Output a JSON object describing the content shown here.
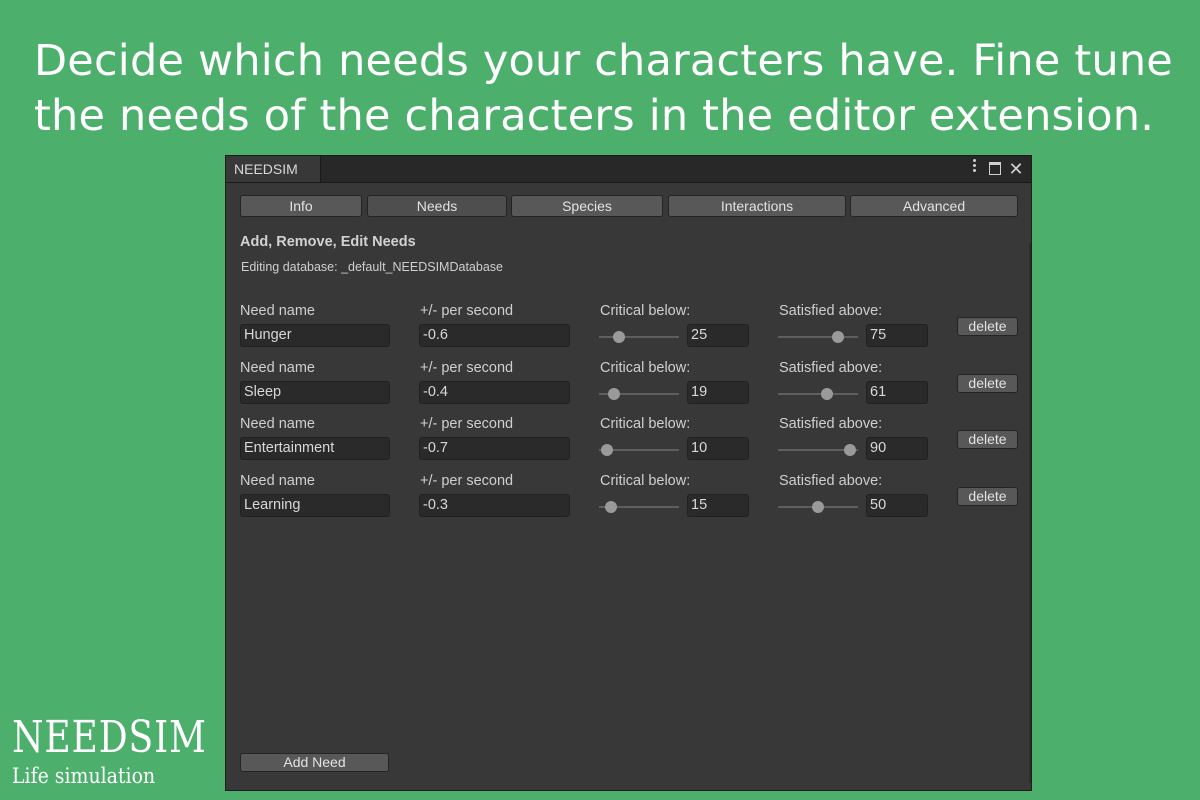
{
  "headline": {
    "line1": "Decide which needs your characters have. Fine tune",
    "line2": "the needs of the characters in the editor extension."
  },
  "logo": {
    "title": "NEEDSIM",
    "subtitle": "Life simulation"
  },
  "window": {
    "tab_title": "NEEDSIM",
    "tabs": [
      {
        "label": "Info"
      },
      {
        "label": "Needs"
      },
      {
        "label": "Species"
      },
      {
        "label": "Interactions"
      },
      {
        "label": "Advanced"
      }
    ],
    "section_title": "Add, Remove, Edit Needs",
    "database_label": "Editing database: _default_NEEDSIMDatabase",
    "labels": {
      "need_name": "Need name",
      "per_second": "+/- per second",
      "critical_below": "Critical below:",
      "satisfied_above": "Satisfied above:",
      "delete": "delete"
    },
    "needs": [
      {
        "name": "Hunger",
        "rate": "-0.6",
        "critical": "25",
        "satisfied": "75"
      },
      {
        "name": "Sleep",
        "rate": "-0.4",
        "critical": "19",
        "satisfied": "61"
      },
      {
        "name": "Entertainment",
        "rate": "-0.7",
        "critical": "10",
        "satisfied": "90"
      },
      {
        "name": "Learning",
        "rate": "-0.3",
        "critical": "15",
        "satisfied": "50"
      }
    ],
    "add_button": "Add Need"
  },
  "icons": [
    "kebab-menu-icon",
    "maximize-icon",
    "close-icon"
  ]
}
